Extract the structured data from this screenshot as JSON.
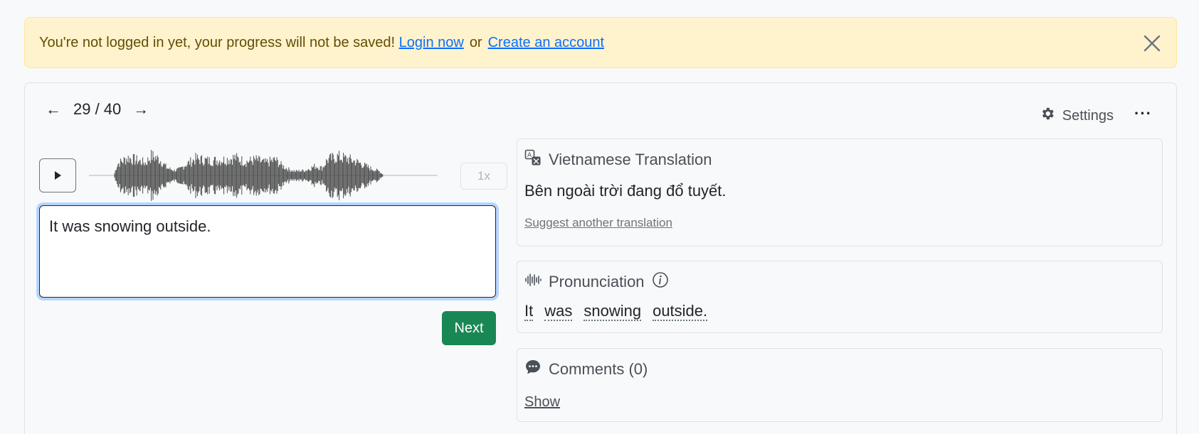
{
  "alert": {
    "message": "You're not logged in yet, your progress will not be saved!",
    "login_link": "Login now",
    "separator": "or",
    "signup_link": "Create an account"
  },
  "nav": {
    "counter": "29 / 40",
    "prev_icon": "arrow-left-icon",
    "next_icon": "arrow-right-icon"
  },
  "toolbar": {
    "settings_label": "Settings",
    "more_label": "···"
  },
  "player": {
    "speed_label": "1x"
  },
  "answer": {
    "value": "It was snowing outside."
  },
  "actions": {
    "next_label": "Next"
  },
  "translation": {
    "title": "Vietnamese Translation",
    "text": "Bên ngoài trời đang đổ tuyết.",
    "suggest_label": "Suggest another translation"
  },
  "pronunciation": {
    "title": "Pronunciation",
    "words": [
      "It",
      "was",
      "snowing",
      "outside."
    ]
  },
  "comments": {
    "title": "Comments (0)",
    "show_label": "Show"
  },
  "colors": {
    "alert_bg": "#fff3cd",
    "link": "#0d6efd",
    "next_button": "#198754",
    "focus_ring": "#b6d4fe"
  }
}
